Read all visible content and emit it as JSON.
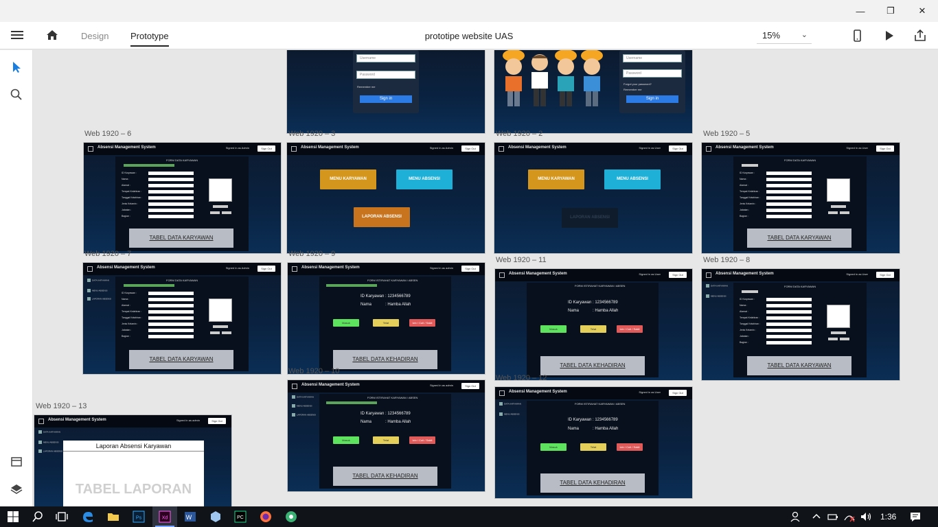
{
  "window": {
    "minimize_glyph": "—",
    "restore_glyph": "❐",
    "close_glyph": "✕"
  },
  "appbar": {
    "tab_design": "Design",
    "tab_prototype": "Prototype",
    "document_title": "prototipe website UAS",
    "zoom": "15%"
  },
  "artboards": {
    "labels": [
      "Web 1920 – 6",
      "Web 1920 – 3",
      "Web 1920 – 2",
      "Web 1920 – 5",
      "Web 1920 – 7",
      "Web 1920 – 9",
      "Web 1920 – 11",
      "Web 1920 – 8",
      "Web 1920 – 10",
      "Web 1920 – 12",
      "Web 1920 – 13"
    ],
    "app_name": "Absensi Management System",
    "signed_admin": "Signed in as Admin",
    "signed_user": "Signed in as User",
    "signed_admin_lower": "Signed in as admin",
    "sign_out": "Sign Out",
    "form_title": "FORM DATA KARYAWAN",
    "form_absen_title": "FORM ISTIRAHAT KARYAWAN / ABSEN",
    "fields": [
      "ID Karyawan :",
      "Nama :",
      "Alamat :",
      "Tempat Kelahiran :",
      "Tanggal Kelahiran :",
      "Jenis Kelamin :",
      "Jabatan :",
      "Bagian :"
    ],
    "tabel_karyawan": "TABEL DATA KARYAWAN",
    "tabel_kehadiran": "TABEL DATA KEHADIRAN",
    "menu_karyawan": "MENU KARYAWAN",
    "menu_absensi": "MENU ABSENSI",
    "laporan_absensi": "LAPORAN ABSENSI",
    "id_line": "ID Karyawan : 1234566789",
    "nama_label": "Nama",
    "nama_value": ": Hamba Allah",
    "btn_masuk": "Masuk",
    "btn_telat": "Telat",
    "btn_izin": "Izin / Cuti / Sakit",
    "side_menu_1": "DATA KARYAWAN",
    "side_menu_2": "MENU ABSENSI",
    "side_menu_3": "LAPORAN ABSENSI",
    "laporan_title": "Laporan Absensi Karyawan",
    "tabel_laporan": "TABEL LAPORAN",
    "login_username": "Username",
    "login_password": "Password",
    "login_remember": "Remember me",
    "login_forgot": "Forgot your password?",
    "login_signin": "Sign in"
  },
  "taskbar": {
    "time": "1:36"
  },
  "colors": {
    "menu_karyawan": "#d4961c",
    "menu_absensi": "#1fb0d8",
    "laporan": "#c8741e",
    "masuk": "#5ee35e",
    "telat": "#e3cf5a",
    "izin": "#e05a5a"
  }
}
